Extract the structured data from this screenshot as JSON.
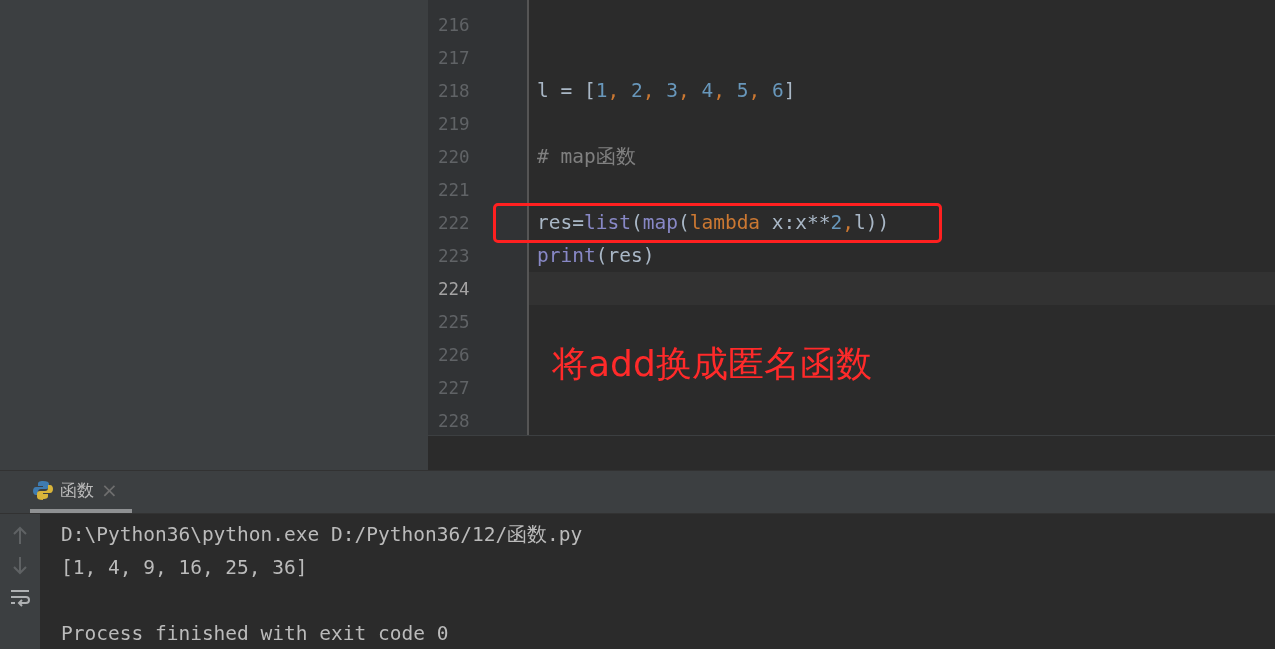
{
  "editor": {
    "lines": [
      {
        "number": "216",
        "current": false,
        "boxed": false
      },
      {
        "number": "217",
        "current": false,
        "boxed": false
      },
      {
        "number": "218",
        "current": false,
        "boxed": false,
        "tokens": [
          {
            "text": "l = [",
            "kind": "plain"
          },
          {
            "text": "1",
            "kind": "number"
          },
          {
            "text": ", ",
            "kind": "keyword"
          },
          {
            "text": "2",
            "kind": "number"
          },
          {
            "text": ", ",
            "kind": "keyword"
          },
          {
            "text": "3",
            "kind": "number"
          },
          {
            "text": ", ",
            "kind": "keyword"
          },
          {
            "text": "4",
            "kind": "number"
          },
          {
            "text": ", ",
            "kind": "keyword"
          },
          {
            "text": "5",
            "kind": "number"
          },
          {
            "text": ", ",
            "kind": "keyword"
          },
          {
            "text": "6",
            "kind": "number"
          },
          {
            "text": "]",
            "kind": "plain"
          }
        ]
      },
      {
        "number": "219",
        "current": false,
        "boxed": false
      },
      {
        "number": "220",
        "current": false,
        "boxed": false,
        "tokens": [
          {
            "text": "# map函数",
            "kind": "comment"
          }
        ]
      },
      {
        "number": "221",
        "current": false,
        "boxed": false
      },
      {
        "number": "222",
        "current": false,
        "boxed": true,
        "tokens": [
          {
            "text": "res=",
            "kind": "plain"
          },
          {
            "text": "list",
            "kind": "builtin"
          },
          {
            "text": "(",
            "kind": "plain"
          },
          {
            "text": "map",
            "kind": "builtin"
          },
          {
            "text": "(",
            "kind": "plain"
          },
          {
            "text": "lambda",
            "kind": "keyword"
          },
          {
            "text": " x:x**",
            "kind": "plain"
          },
          {
            "text": "2",
            "kind": "number"
          },
          {
            "text": ",",
            "kind": "keyword"
          },
          {
            "text": "l))",
            "kind": "plain"
          }
        ]
      },
      {
        "number": "223",
        "current": false,
        "boxed": false,
        "tokens": [
          {
            "text": "print",
            "kind": "builtin"
          },
          {
            "text": "(res)",
            "kind": "plain"
          }
        ]
      },
      {
        "number": "224",
        "current": true,
        "boxed": false
      },
      {
        "number": "225",
        "current": false,
        "boxed": false
      },
      {
        "number": "226",
        "current": false,
        "boxed": false
      },
      {
        "number": "227",
        "current": false,
        "boxed": false
      },
      {
        "number": "228",
        "current": false,
        "boxed": false
      }
    ],
    "annotation": "将add换成匿名函数"
  },
  "run_panel": {
    "tabs": [
      {
        "label": "函数",
        "close": "×",
        "selected": true
      }
    ],
    "output": [
      "D:\\Python36\\python.exe D:/Python36/12/函数.py",
      "[1, 4, 9, 16, 25, 36]"
    ],
    "exit_message": "Process finished with exit code 0"
  }
}
